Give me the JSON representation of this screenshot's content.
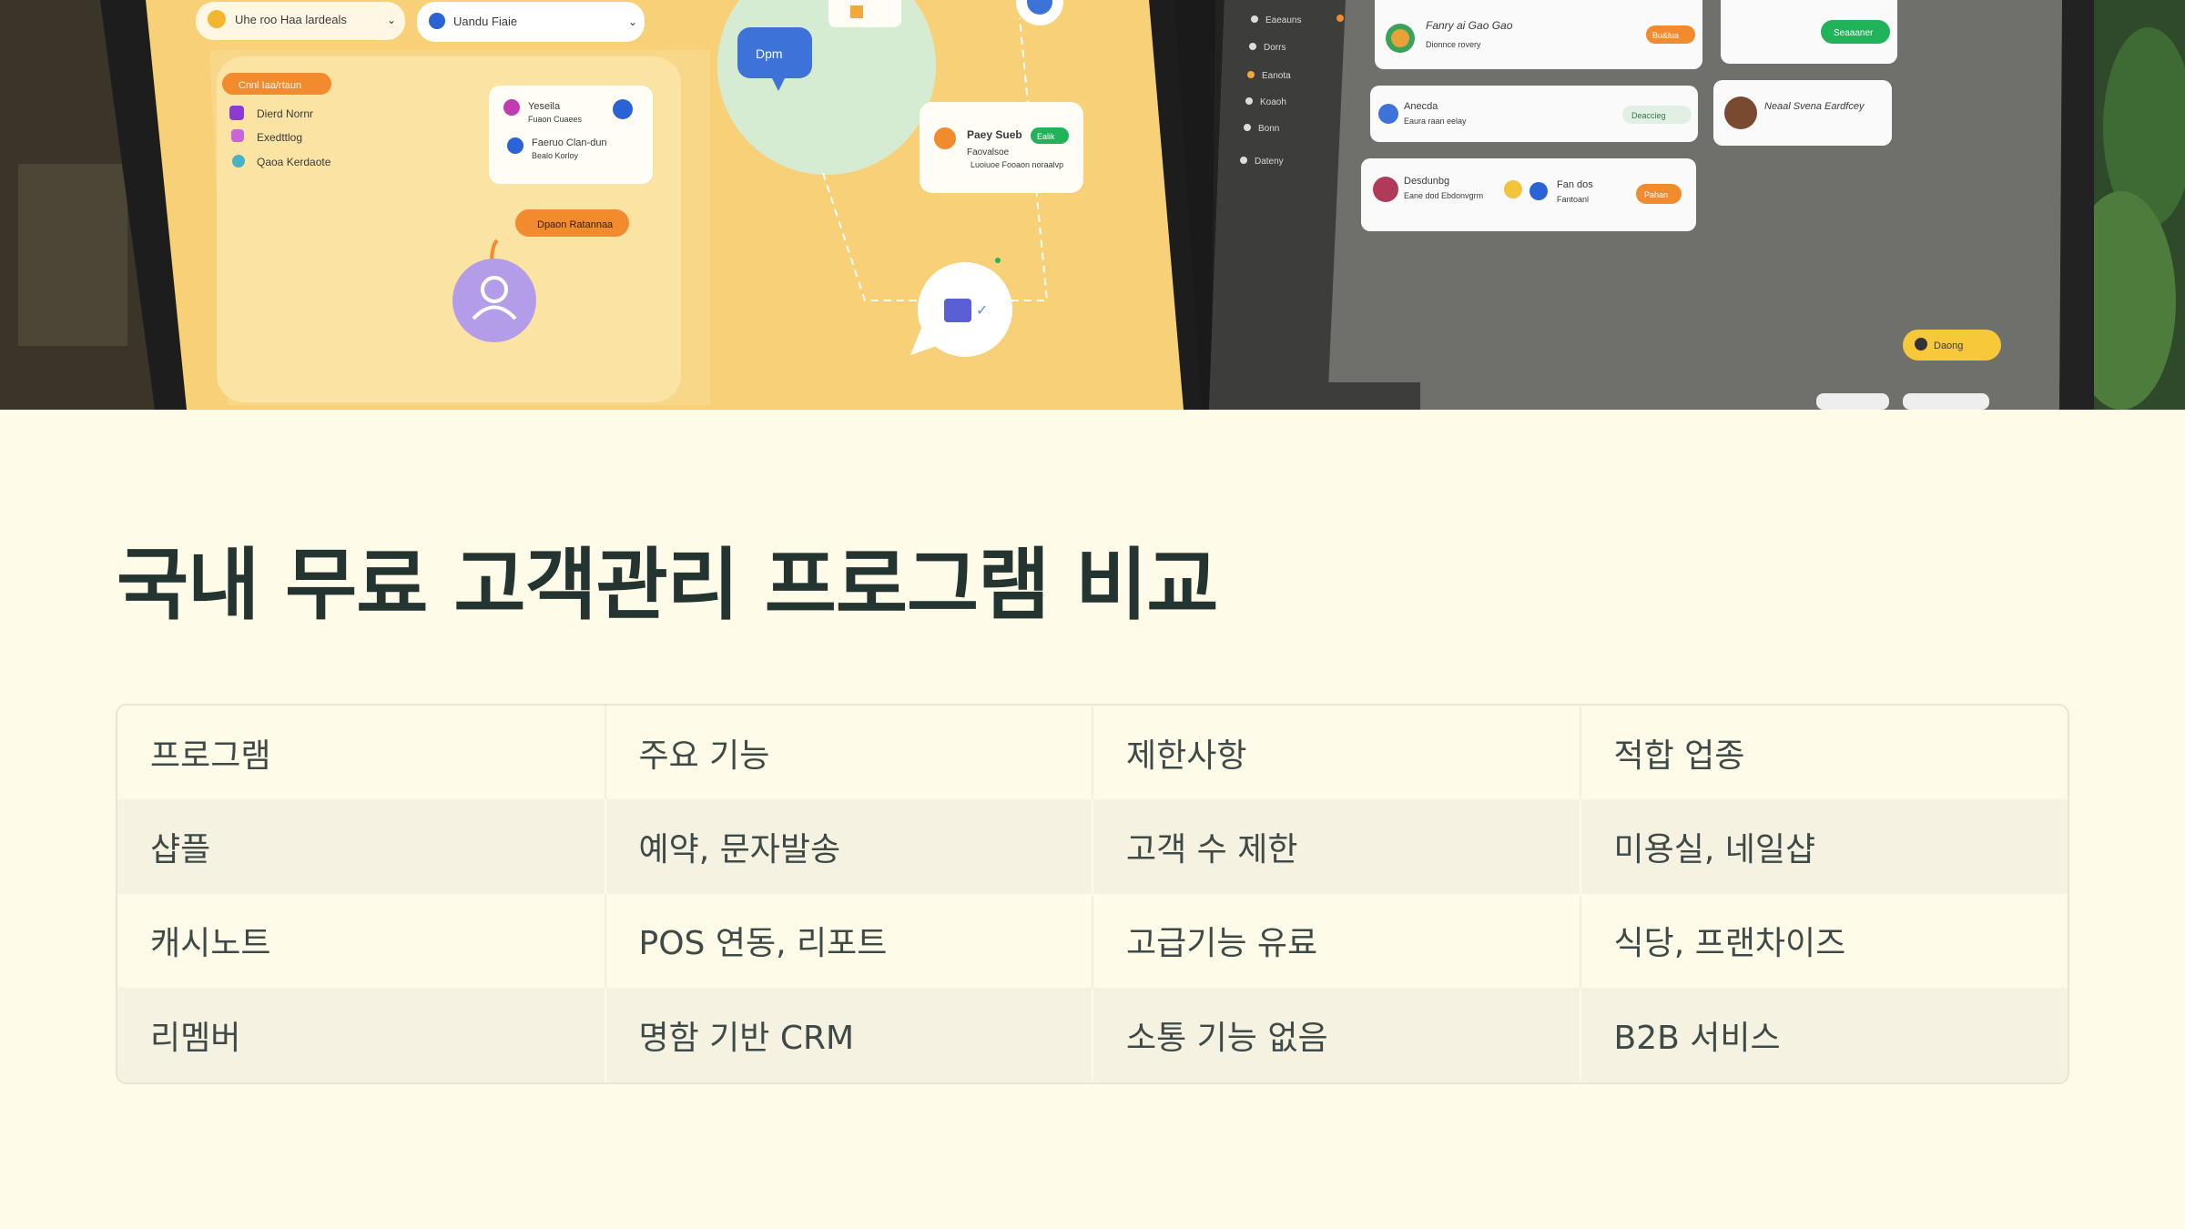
{
  "hero": {
    "illustration": "crm-dashboard-screens",
    "left_screen": {
      "dropdowns": [
        "Uhe roo Haa lardeals",
        "Uandu Fiaie"
      ],
      "menu_header": "Cnnl Iaa/rtaun",
      "menu_items": [
        "Dierd Nornr",
        "Exedttlog",
        "Qaoa Kerdaote"
      ],
      "card_title": "Yeseila",
      "card_sub": "Fuaon Cuaees",
      "card_title2": "Faeruo Clan-dun",
      "card_sub2": "Bealo Korloy",
      "chat_label": "Dpm",
      "status_pill": "Dpaon Ratannaa",
      "card3_title": "Paey Sueb",
      "card3_tag": "Ealik",
      "card3_sub": "Faovalsoe",
      "card3_sub2": "Luoiuoe Fooaon noraalvp"
    },
    "right_screen": {
      "sidebar_items": [
        "Eaeauns",
        "Dorrs",
        "Eanota",
        "Koaoh",
        "Bonn",
        "Dateny"
      ],
      "row1_title": "Fanry ai Gao Gao",
      "row1_sub": "Dionnce rovery",
      "row1_badge": "Bu&lua",
      "card2_btn": "Seaaaner",
      "row2_title": "Anecda",
      "row2_sub": "Eaura raan eelay",
      "row2_badge": "Deaccieg",
      "row3_title": "Neaal Svena Eardfcey",
      "row4_title": "Desdunbg",
      "row4_sub": "Eane dod Ebdonvgrm",
      "row4_mid": "Fan dos",
      "row4_mid_sub": "Fantoanl",
      "row4_badge": "Pahan",
      "pill": "Daong"
    }
  },
  "title": "국내 무료 고객관리 프로그램 비교",
  "table": {
    "headers": [
      "프로그램",
      "주요 기능",
      "제한사항",
      "적합 업종"
    ],
    "rows": [
      [
        "샵플",
        "예약, 문자발송",
        "고객 수 제한",
        "미용실, 네일샵"
      ],
      [
        "캐시노트",
        "POS 연동, 리포트",
        "고급기능 유료",
        "식당, 프랜차이즈"
      ],
      [
        "리멤버",
        "명함 기반 CRM",
        "소통 기능 없음",
        "B2B 서비스"
      ]
    ]
  },
  "colors": {
    "background": "#fefbe9",
    "title": "#233431",
    "row_alt": "#f5f2e1",
    "hero_yellow": "#f7cf67",
    "hero_gray": "#6f6f6c",
    "accent_orange": "#f28a2e",
    "accent_green": "#22b35a",
    "accent_purple": "#b49de8"
  }
}
